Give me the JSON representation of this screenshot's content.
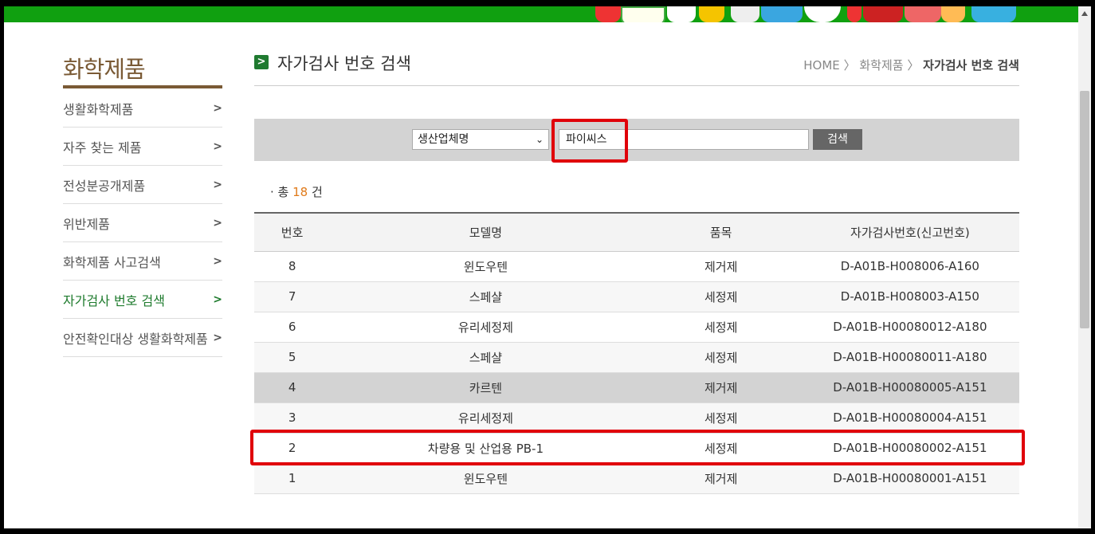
{
  "sidebar": {
    "title": "화학제품",
    "items": [
      {
        "label": "생활화학제품",
        "active": false
      },
      {
        "label": "자주 찾는 제품",
        "active": false
      },
      {
        "label": "전성분공개제품",
        "active": false
      },
      {
        "label": "위반제품",
        "active": false
      },
      {
        "label": "화학제품 사고검색",
        "active": false
      },
      {
        "label": "자가검사 번호 검색",
        "active": true
      },
      {
        "label": "안전확인대상 생활화학제품",
        "active": false
      }
    ]
  },
  "header": {
    "title": "자가검사 번호 검색",
    "breadcrumb": [
      "HOME",
      "화학제품",
      "자가검사 번호 검색"
    ]
  },
  "search": {
    "select_value": "생산업체명",
    "input_value": "파이씨스",
    "button_label": "검색"
  },
  "summary": {
    "prefix": "· 총",
    "count": "18",
    "suffix": "건"
  },
  "table": {
    "headers": [
      "번호",
      "모델명",
      "품목",
      "자가검사번호(신고번호)"
    ],
    "rows": [
      [
        "8",
        "윈도우텐",
        "제거제",
        "D-A01B-H008006-A160"
      ],
      [
        "7",
        "스페샬",
        "세정제",
        "D-A01B-H008003-A150"
      ],
      [
        "6",
        "유리세정제",
        "세정제",
        "D-A01B-H00080012-A180"
      ],
      [
        "5",
        "스페샬",
        "세정제",
        "D-A01B-H00080011-A180"
      ],
      [
        "4",
        "카르텐",
        "제거제",
        "D-A01B-H00080005-A151"
      ],
      [
        "3",
        "유리세정제",
        "세정제",
        "D-A01B-H00080004-A151"
      ],
      [
        "2",
        "차량용 및 산업용 PB-1",
        "세정제",
        "D-A01B-H00080002-A151"
      ],
      [
        "1",
        "윈도우텐",
        "제거제",
        "D-A01B-H00080001-A151"
      ]
    ]
  },
  "colors": {
    "accent_green": "#1d7a2c",
    "sidebar_brown": "#7a5a35",
    "count_orange": "#e07a1a",
    "highlight_red": "#e0000a"
  }
}
